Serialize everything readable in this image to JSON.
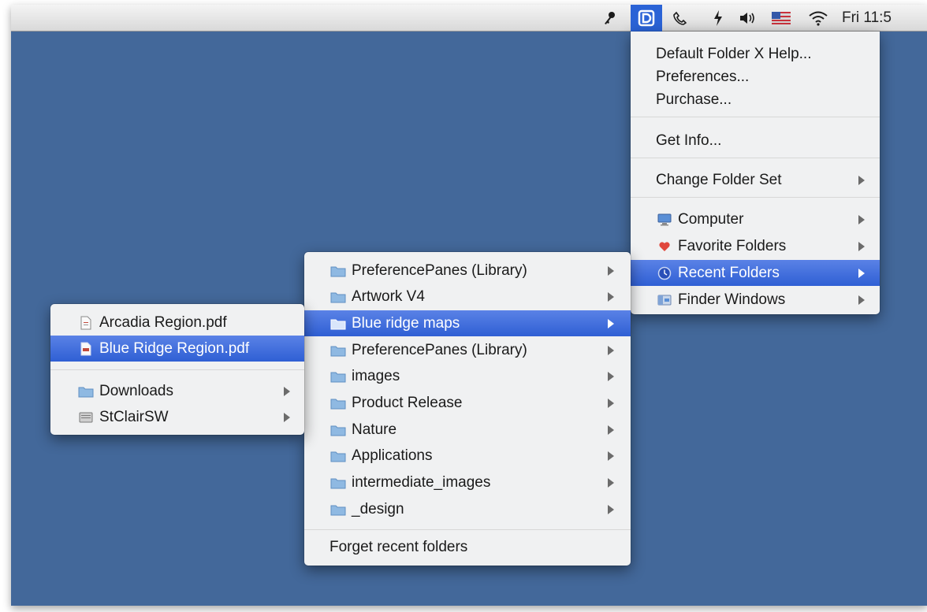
{
  "menubar": {
    "clock": "Fri 11:5",
    "icons": [
      "key-icon",
      "default-folder-x-icon",
      "phone-icon",
      "flash-icon",
      "volume-icon",
      "flag-icon",
      "wifi-icon"
    ]
  },
  "dfx_menu": {
    "help": "Default Folder X Help...",
    "preferences": "Preferences...",
    "purchase": "Purchase...",
    "get_info": "Get Info...",
    "change_folder_set": "Change Folder Set",
    "computer": "Computer",
    "favorite_folders": "Favorite Folders",
    "recent_folders": "Recent Folders",
    "finder_windows": "Finder Windows"
  },
  "recent_menu": {
    "items": [
      "PreferencePanes (Library)",
      "Artwork V4",
      "Blue ridge maps",
      "PreferencePanes (Library)",
      "images",
      "Product Release",
      "Nature",
      "Applications",
      "intermediate_images",
      "_design"
    ],
    "selected": "Blue ridge maps",
    "forget": "Forget recent folders"
  },
  "folder_menu": {
    "files": [
      "Arcadia Region.pdf",
      "Blue Ridge Region.pdf"
    ],
    "selected": "Blue Ridge Region.pdf",
    "folders": [
      "Downloads",
      "StClairSW"
    ]
  },
  "colors": {
    "desktop": "#43689a",
    "highlight": "#2f5fd4",
    "folder": "#8fb9e2"
  }
}
